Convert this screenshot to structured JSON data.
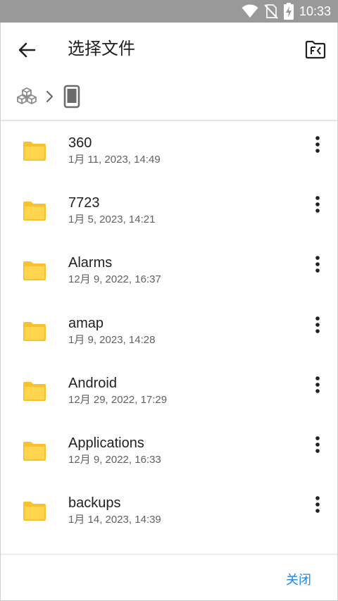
{
  "status_bar": {
    "time": "10:33"
  },
  "header": {
    "title": "选择文件"
  },
  "files": [
    {
      "name": "360",
      "date": "1月 11, 2023, 14:49"
    },
    {
      "name": "7723",
      "date": "1月 5, 2023, 14:21"
    },
    {
      "name": "Alarms",
      "date": "12月 9, 2022, 16:37"
    },
    {
      "name": "amap",
      "date": "1月 9, 2023, 14:28"
    },
    {
      "name": "Android",
      "date": "12月 29, 2022, 17:29"
    },
    {
      "name": "Applications",
      "date": "12月 9, 2022, 16:33"
    },
    {
      "name": "backups",
      "date": "1月 14, 2023, 14:39"
    }
  ],
  "footer": {
    "close_label": "关闭"
  },
  "colors": {
    "folder": "#FBC02D",
    "accent": "#1E88E5",
    "status_bar": "#999999"
  }
}
